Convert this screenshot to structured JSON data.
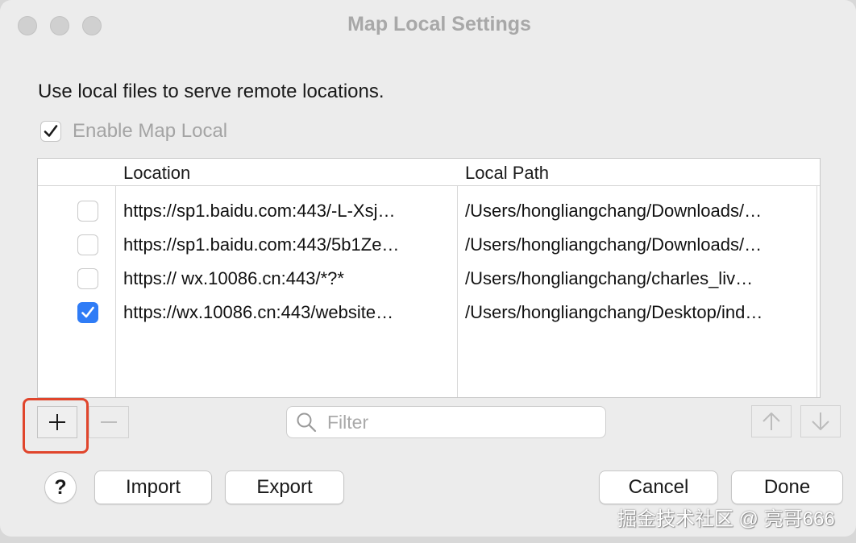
{
  "window": {
    "title": "Map Local Settings"
  },
  "description": "Use local files to serve remote locations.",
  "enable": {
    "label": "Enable Map Local",
    "checked": true
  },
  "table": {
    "columns": [
      "Location",
      "Local Path"
    ],
    "rows": [
      {
        "checked": false,
        "location": "https://sp1.baidu.com:443/-L-Xsj…",
        "path": "/Users/hongliangchang/Downloads/…"
      },
      {
        "checked": false,
        "location": "https://sp1.baidu.com:443/5b1Ze…",
        "path": "/Users/hongliangchang/Downloads/…"
      },
      {
        "checked": false,
        "location": "https:// wx.10086.cn:443/*?*",
        "path": "/Users/hongliangchang/charles_liv…"
      },
      {
        "checked": true,
        "location": "https://wx.10086.cn:443/website…",
        "path": "/Users/hongliangchang/Desktop/ind…"
      }
    ]
  },
  "toolbar": {
    "add_icon": "plus-icon",
    "remove_icon": "minus-icon",
    "move_up_icon": "arrow-up-icon",
    "move_down_icon": "arrow-down-icon"
  },
  "filter": {
    "placeholder": "Filter",
    "value": ""
  },
  "buttons": {
    "help": "?",
    "import": "Import",
    "export": "Export",
    "cancel": "Cancel",
    "done": "Done"
  },
  "watermark": "掘金技术社区 @ 亮哥666",
  "colors": {
    "accent": "#2f7cf6",
    "highlight": "#e0452c"
  }
}
